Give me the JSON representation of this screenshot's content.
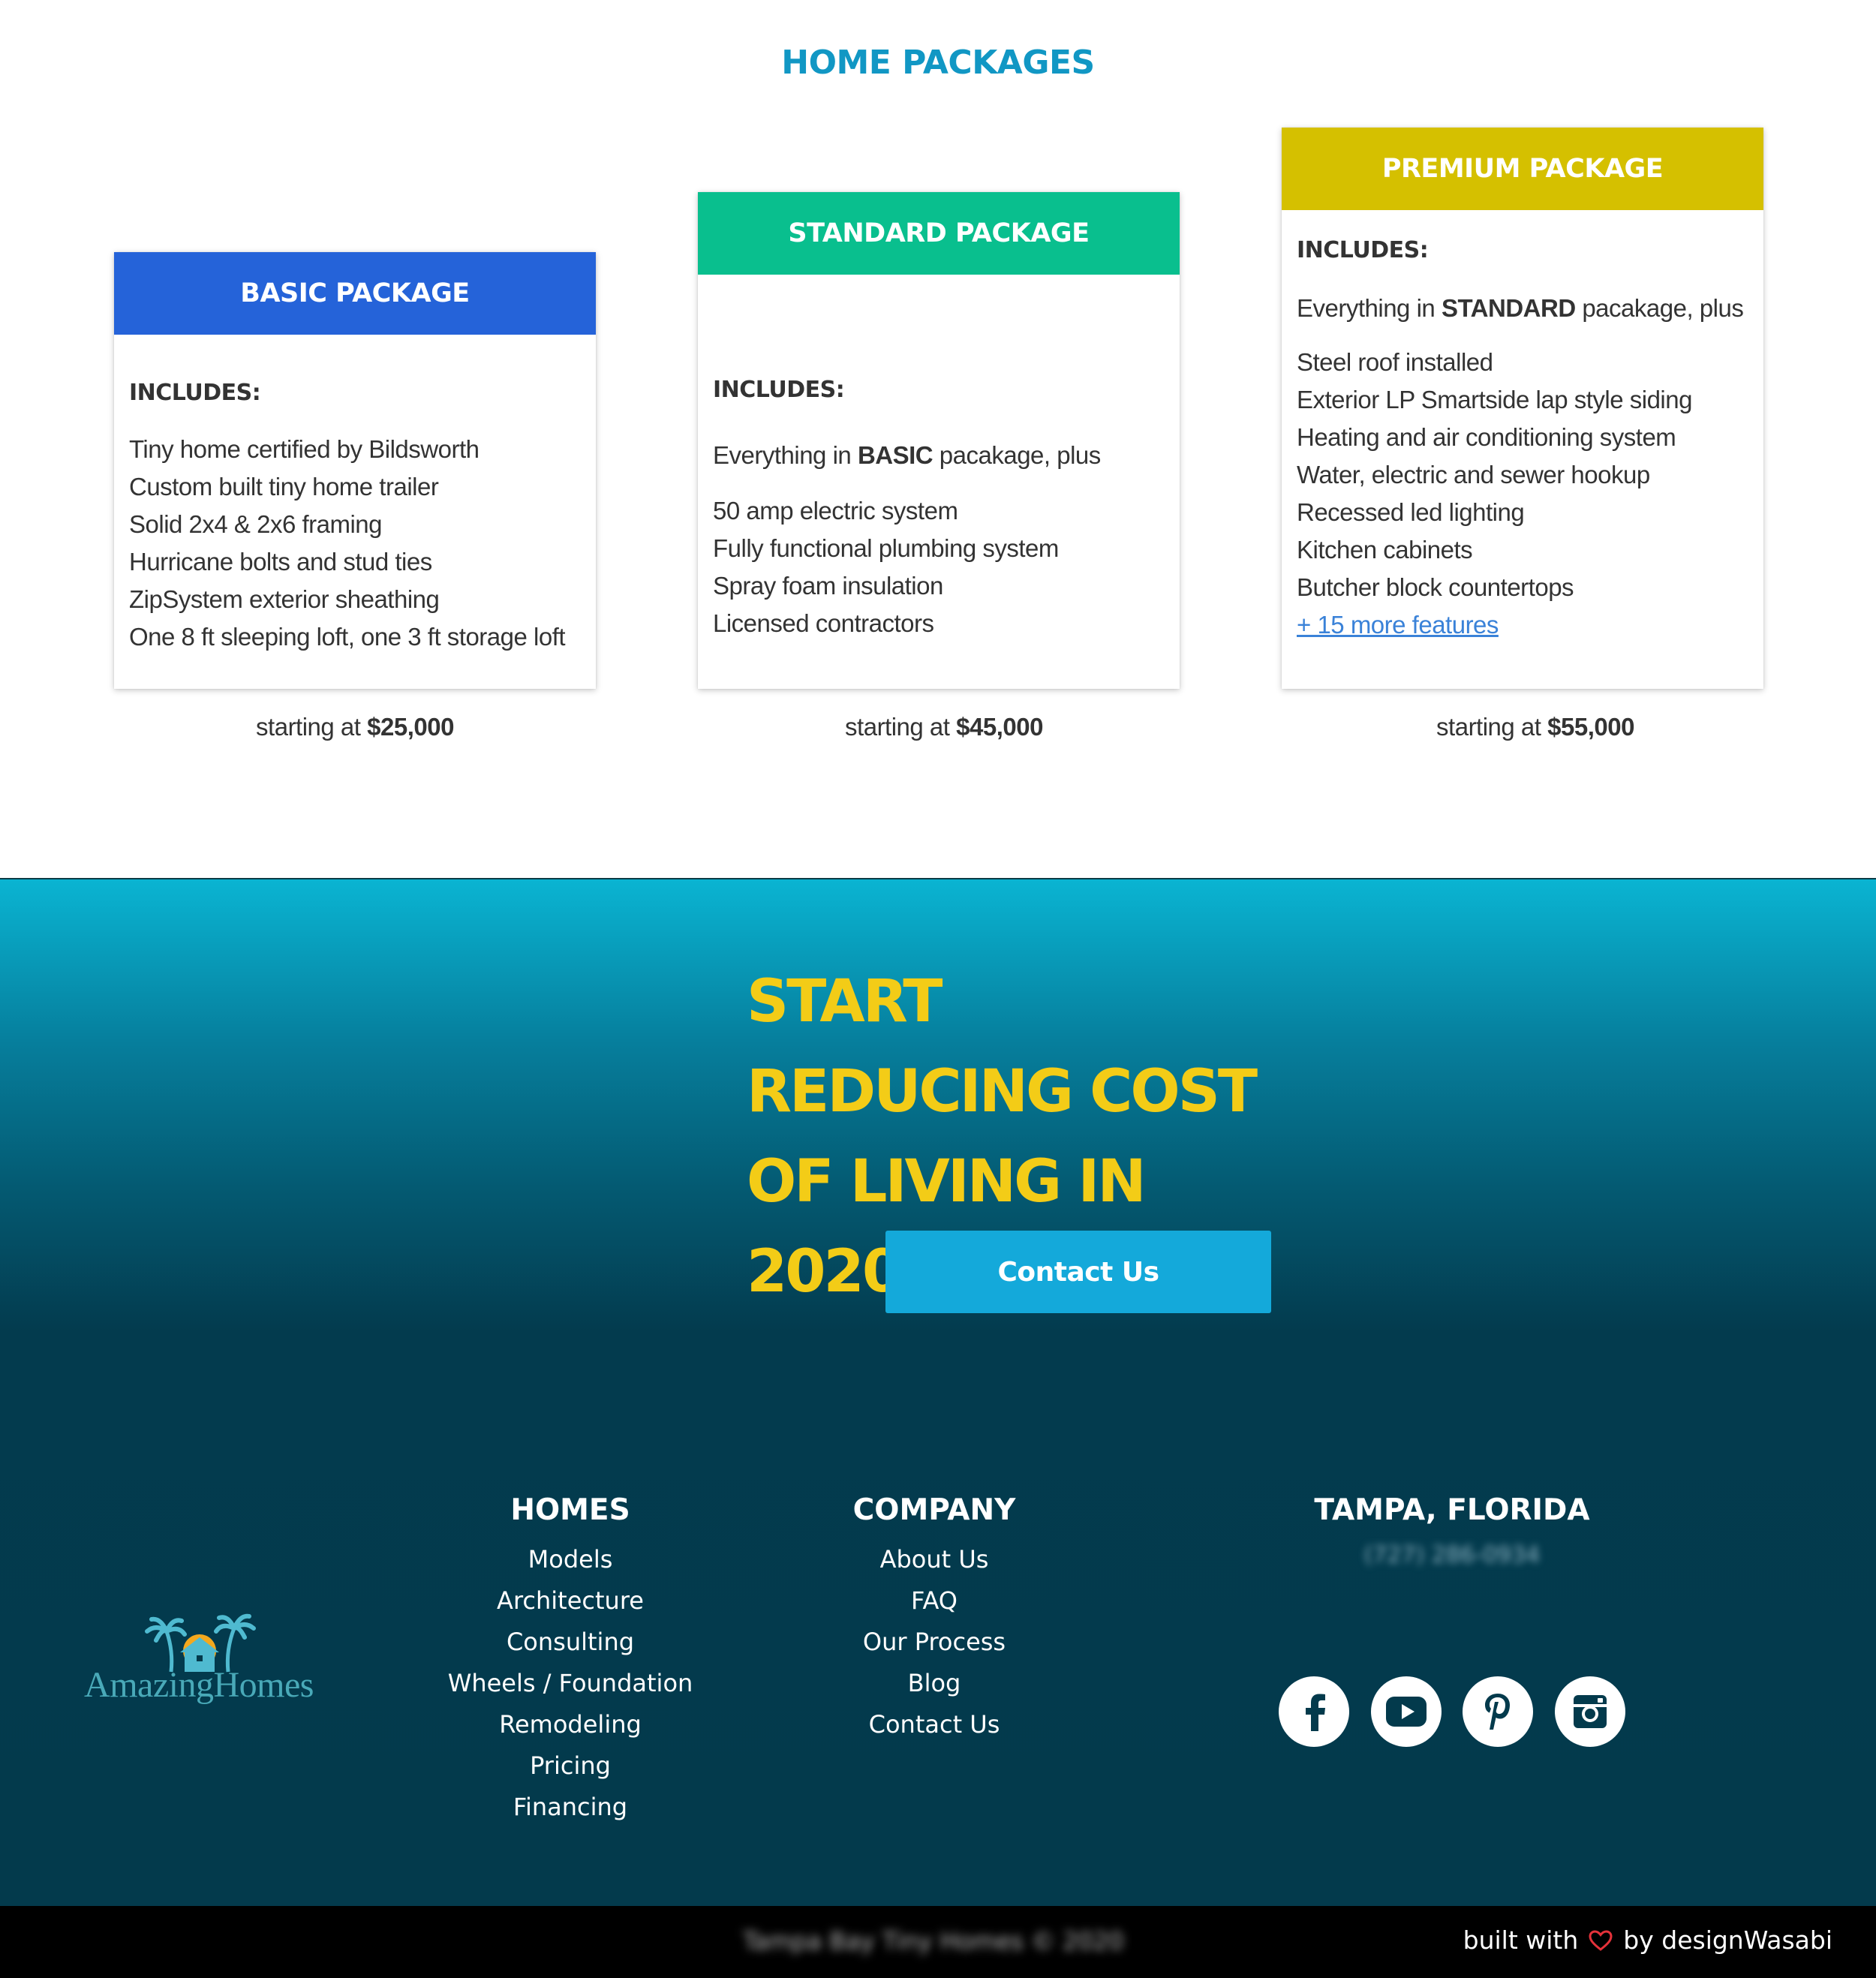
{
  "packages": {
    "title": "HOME PACKAGES",
    "basic": {
      "name": "BASIC PACKAGE",
      "includes_label": "INCLUDES:",
      "features": [
        "Tiny home certified by Bildsworth",
        "Custom built tiny home trailer",
        "Solid 2x4 & 2x6 framing",
        "Hurricane bolts and stud ties",
        "ZipSystem exterior sheathing",
        "One 8 ft sleeping loft, one 3 ft storage loft"
      ],
      "price_prefix": "starting at",
      "price": "$25,000",
      "accent": "#2563d9"
    },
    "standard": {
      "name": "STANDARD PACKAGE",
      "includes_label": "INCLUDES:",
      "intro_before": "Everything in",
      "intro_bold": "BASIC",
      "intro_after": "pacakage, plus",
      "features": [
        "50 amp electric system",
        "Fully functional plumbing system",
        "Spray foam insulation",
        "Licensed contractors"
      ],
      "price_prefix": "starting at",
      "price": "$45,000",
      "accent": "#09bf8e"
    },
    "premium": {
      "name": "PREMIUM PACKAGE",
      "includes_label": "INCLUDES:",
      "intro_before": "Everything in",
      "intro_bold": "STANDARD",
      "intro_after": "pacakage, plus",
      "features": [
        "Steel roof installed",
        "Exterior LP Smartside lap style siding",
        "Heating and air conditioning system",
        "Water, electric and sewer hookup",
        "Recessed led lighting",
        "Kitchen cabinets",
        "Butcher block countertops"
      ],
      "more_link": "+ 15 more features",
      "price_prefix": "starting at",
      "price": "$55,000",
      "accent": "#d5c000"
    }
  },
  "cta": {
    "lines": [
      "START",
      "REDUCING COST",
      "OF LIVING IN",
      "2020"
    ],
    "button": "Contact Us",
    "headline_color": "#f3cc17",
    "button_color": "#14a9da"
  },
  "footer": {
    "logo_text": "AmazingHomes",
    "homes": {
      "title": "HOMES",
      "links": [
        "Models",
        "Architecture",
        "Consulting",
        "Wheels / Foundation",
        "Remodeling",
        "Pricing",
        "Financing"
      ]
    },
    "company": {
      "title": "COMPANY",
      "links": [
        "About Us",
        "FAQ",
        "Our Process",
        "Blog",
        "Contact Us"
      ]
    },
    "location": {
      "title": "TAMPA, FLORIDA",
      "phone": "(727) 286-0934"
    },
    "social": [
      "facebook-icon",
      "youtube-icon",
      "pinterest-icon",
      "instagram-icon"
    ],
    "copyright": "Tampa Bay Tiny Homes © 2020",
    "built_before": "built with",
    "built_after": "by designWasabi"
  }
}
